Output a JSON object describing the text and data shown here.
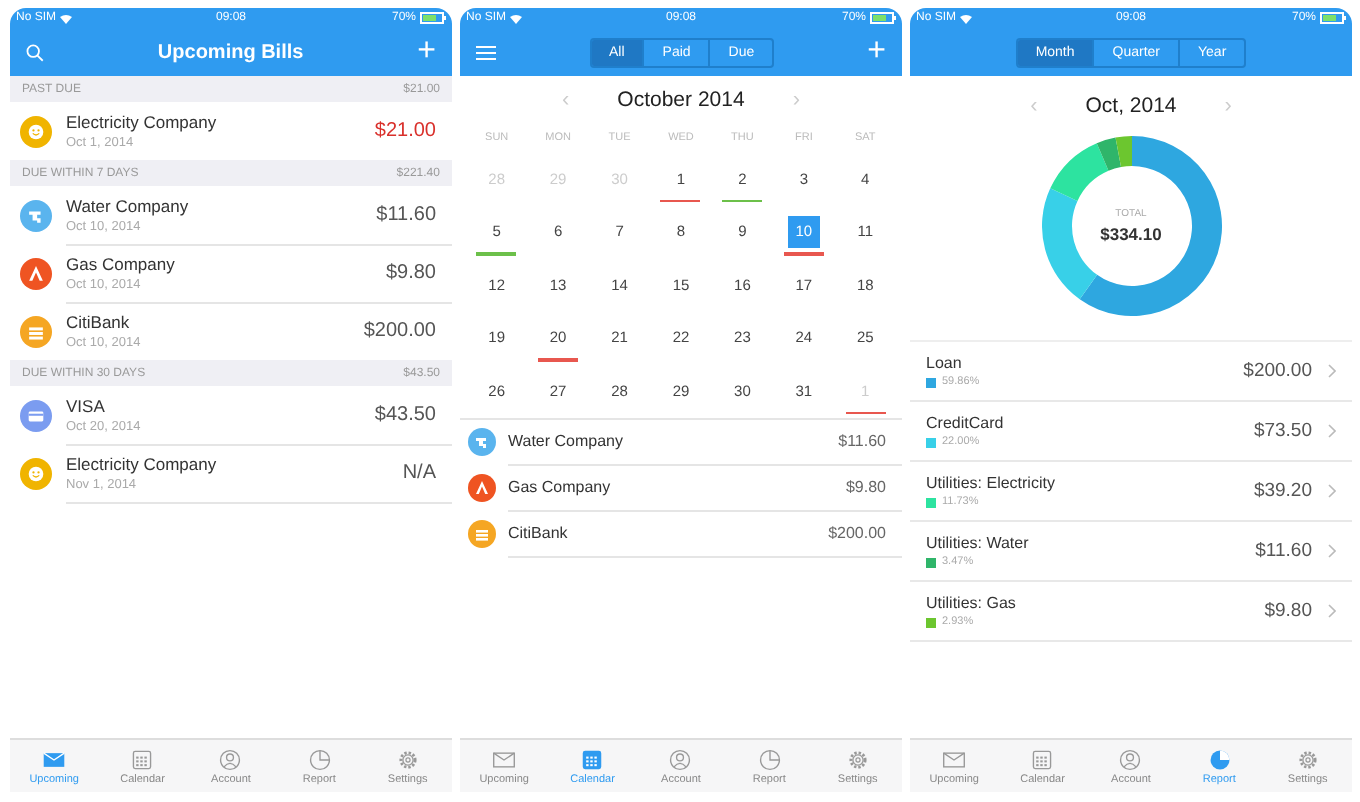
{
  "upcoming_screen": {
    "status_bar": {
      "carrier": "No SIM",
      "time": "09:08",
      "battery": "70%"
    },
    "title": "Upcoming Bills",
    "add": "+",
    "sections": [
      {
        "header": "PAST DUE",
        "total": "$21.00",
        "bills": [
          {
            "name": "Electricity Company",
            "date": "Oct 1, 2014",
            "amount": "$21.00",
            "overdue": true,
            "kind": "smile",
            "color": "#f0b400"
          }
        ]
      },
      {
        "header": "DUE WITHIN 7 DAYS",
        "total": "$221.40",
        "bills": [
          {
            "name": "Water Company",
            "date": "Oct 10, 2014",
            "amount": "$11.60",
            "overdue": false,
            "kind": "tap",
            "color": "#5ab4ee"
          },
          {
            "name": "Gas Company",
            "date": "Oct 10, 2014",
            "amount": "$9.80",
            "overdue": false,
            "kind": "flame",
            "color": "#ef5422"
          },
          {
            "name": "CitiBank",
            "date": "Oct 10, 2014",
            "amount": "$200.00",
            "overdue": false,
            "kind": "coins",
            "color": "#f5a623"
          }
        ]
      },
      {
        "header": "DUE WITHIN 30 DAYS",
        "total": "$43.50",
        "bills": [
          {
            "name": "VISA",
            "date": "Oct 20, 2014",
            "amount": "$43.50",
            "overdue": false,
            "kind": "card",
            "color": "#7b9cf0"
          },
          {
            "name": "Electricity Company",
            "date": "Nov 1, 2014",
            "amount": "N/A",
            "overdue": false,
            "kind": "smile",
            "color": "#f0b400"
          }
        ]
      }
    ],
    "tab_bar": [
      {
        "label": "Upcoming",
        "kind": "mail",
        "selected": true
      },
      {
        "label": "Calendar",
        "kind": "calendar",
        "selected": false
      },
      {
        "label": "Account",
        "kind": "account",
        "selected": false
      },
      {
        "label": "Report",
        "kind": "report",
        "selected": false
      },
      {
        "label": "Settings",
        "kind": "settings",
        "selected": false
      }
    ]
  },
  "calendar_screen": {
    "status_bar": {
      "carrier": "No SIM",
      "time": "09:08",
      "battery": "70%"
    },
    "filter": [
      {
        "label": "All",
        "selected": true
      },
      {
        "label": "Paid",
        "selected": false
      },
      {
        "label": "Due",
        "selected": false
      }
    ],
    "add": "+",
    "month": "October 2014",
    "prev": "‹",
    "next": "›",
    "weekdays": [
      "SUN",
      "MON",
      "TUE",
      "WED",
      "THU",
      "FRI",
      "SAT"
    ],
    "days": [
      {
        "label": "28",
        "muted": true,
        "selected": false
      },
      {
        "label": "29",
        "muted": true,
        "selected": false
      },
      {
        "label": "30",
        "muted": true,
        "selected": false
      },
      {
        "label": "1",
        "muted": false,
        "selected": false,
        "color": "#e8574f"
      },
      {
        "label": "2",
        "muted": false,
        "selected": false,
        "color": "#6cc04a"
      },
      {
        "label": "3",
        "muted": false,
        "selected": false
      },
      {
        "label": "4",
        "muted": false,
        "selected": false
      },
      {
        "label": "5",
        "muted": false,
        "selected": false,
        "color": "#6cc04a"
      },
      {
        "label": "6",
        "muted": false,
        "selected": false
      },
      {
        "label": "7",
        "muted": false,
        "selected": false
      },
      {
        "label": "8",
        "muted": false,
        "selected": false
      },
      {
        "label": "9",
        "muted": false,
        "selected": false
      },
      {
        "label": "10",
        "muted": false,
        "selected": true,
        "color": "#e8574f"
      },
      {
        "label": "11",
        "muted": false,
        "selected": false
      },
      {
        "label": "12",
        "muted": false,
        "selected": false
      },
      {
        "label": "13",
        "muted": false,
        "selected": false
      },
      {
        "label": "14",
        "muted": false,
        "selected": false
      },
      {
        "label": "15",
        "muted": false,
        "selected": false
      },
      {
        "label": "16",
        "muted": false,
        "selected": false
      },
      {
        "label": "17",
        "muted": false,
        "selected": false
      },
      {
        "label": "18",
        "muted": false,
        "selected": false
      },
      {
        "label": "19",
        "muted": false,
        "selected": false
      },
      {
        "label": "20",
        "muted": false,
        "selected": false,
        "color": "#e8574f"
      },
      {
        "label": "21",
        "muted": false,
        "selected": false
      },
      {
        "label": "22",
        "muted": false,
        "selected": false
      },
      {
        "label": "23",
        "muted": false,
        "selected": false
      },
      {
        "label": "24",
        "muted": false,
        "selected": false
      },
      {
        "label": "25",
        "muted": false,
        "selected": false
      },
      {
        "label": "26",
        "muted": false,
        "selected": false
      },
      {
        "label": "27",
        "muted": false,
        "selected": false
      },
      {
        "label": "28",
        "muted": false,
        "selected": false
      },
      {
        "label": "29",
        "muted": false,
        "selected": false
      },
      {
        "label": "30",
        "muted": false,
        "selected": false
      },
      {
        "label": "31",
        "muted": false,
        "selected": false
      },
      {
        "label": "1",
        "muted": true,
        "selected": false,
        "color": "#e8574f"
      }
    ],
    "bills": [
      {
        "name": "Water Company",
        "amount": "$11.60",
        "kind": "tap",
        "color": "#5ab4ee"
      },
      {
        "name": "Gas Company",
        "amount": "$9.80",
        "kind": "flame",
        "color": "#ef5422"
      },
      {
        "name": "CitiBank",
        "amount": "$200.00",
        "kind": "coins",
        "color": "#f5a623"
      }
    ],
    "tab_bar": [
      {
        "label": "Upcoming",
        "kind": "mail",
        "selected": false
      },
      {
        "label": "Calendar",
        "kind": "calendar",
        "selected": true
      },
      {
        "label": "Account",
        "kind": "account",
        "selected": false
      },
      {
        "label": "Report",
        "kind": "report",
        "selected": false
      },
      {
        "label": "Settings",
        "kind": "settings",
        "selected": false
      }
    ]
  },
  "report_screen": {
    "status_bar": {
      "carrier": "No SIM",
      "time": "09:08",
      "battery": "70%"
    },
    "period": [
      {
        "label": "Month",
        "selected": true
      },
      {
        "label": "Quarter",
        "selected": false
      },
      {
        "label": "Year",
        "selected": false
      }
    ],
    "month": "Oct, 2014",
    "prev": "‹",
    "next": "›",
    "total_label": "TOTAL",
    "total": "$334.10",
    "chart_data": {
      "type": "donut",
      "values": [
        59.86,
        22.0,
        11.73,
        3.47,
        2.93
      ]
    },
    "categories": [
      {
        "name": "Loan",
        "share": "59.86%",
        "amount": "$200.00",
        "color": "#2ea7e0"
      },
      {
        "name": "CreditCard",
        "share": "22.00%",
        "amount": "$73.50",
        "color": "#38d0e8"
      },
      {
        "name": "Utilities: Electricity",
        "share": "11.73%",
        "amount": "$39.20",
        "color": "#2de3a0"
      },
      {
        "name": "Utilities: Water",
        "share": "3.47%",
        "amount": "$11.60",
        "color": "#2fb56a"
      },
      {
        "name": "Utilities: Gas",
        "share": "2.93%",
        "amount": "$9.80",
        "color": "#6cc62f"
      }
    ],
    "tab_bar": [
      {
        "label": "Upcoming",
        "kind": "mail",
        "selected": false
      },
      {
        "label": "Calendar",
        "kind": "calendar",
        "selected": false
      },
      {
        "label": "Account",
        "kind": "account",
        "selected": false
      },
      {
        "label": "Report",
        "kind": "report",
        "selected": true
      },
      {
        "label": "Settings",
        "kind": "settings",
        "selected": false
      }
    ]
  }
}
